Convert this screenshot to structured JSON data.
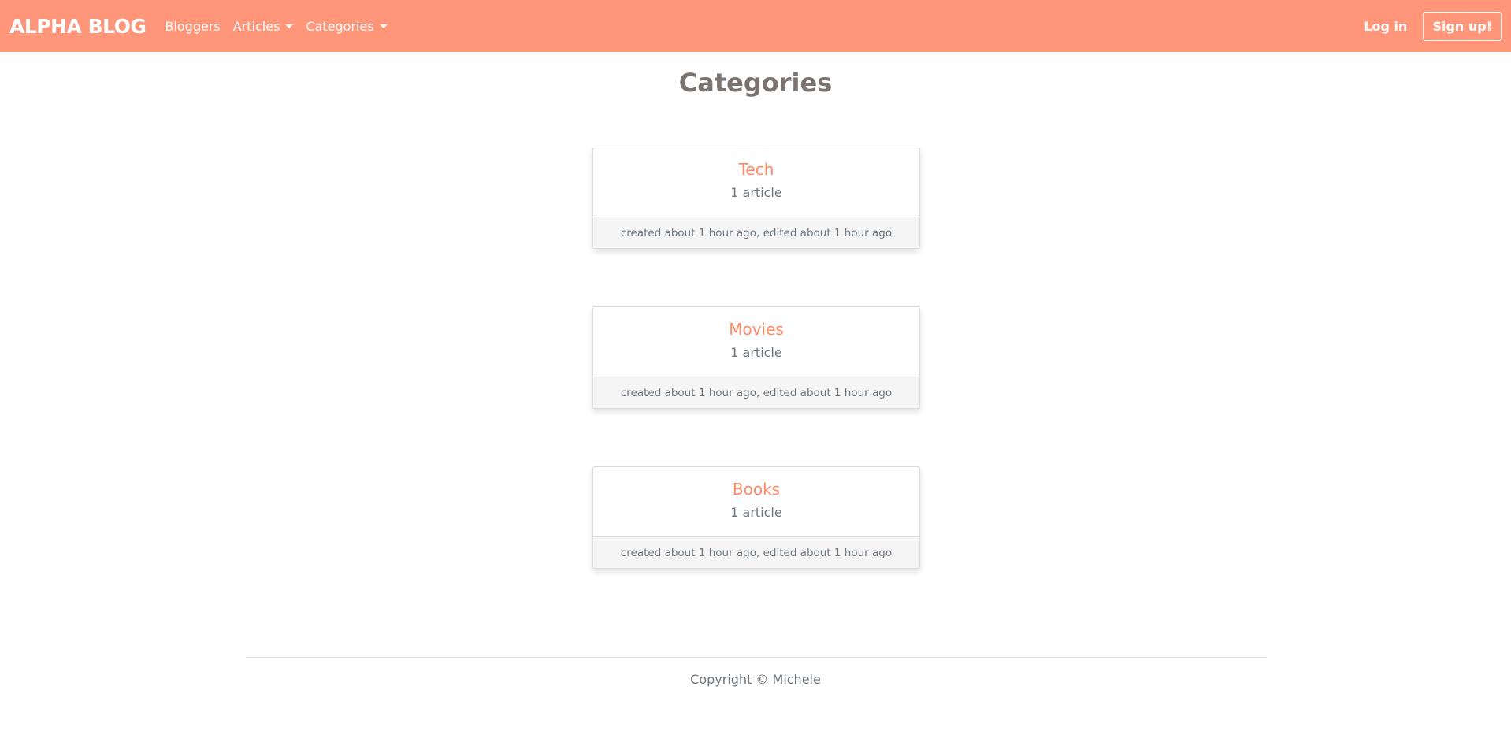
{
  "nav": {
    "brand": "ALPHA BLOG",
    "bloggers": "Bloggers",
    "articles": "Articles",
    "categories": "Categories",
    "login": "Log in",
    "signup": "Sign up!",
    "bg_color": "#ff967a"
  },
  "page": {
    "title": "Categories"
  },
  "categories": [
    {
      "name": "Tech",
      "count": "1 article",
      "meta": "created about 1 hour ago, edited about 1 hour ago"
    },
    {
      "name": "Movies",
      "count": "1 article",
      "meta": "created about 1 hour ago, edited about 1 hour ago"
    },
    {
      "name": "Books",
      "count": "1 article",
      "meta": "created about 1 hour ago, edited about 1 hour ago"
    }
  ],
  "footer": {
    "copyright": "Copyright © Michele"
  },
  "colors": {
    "accent": "#ff8a65",
    "muted_text": "#6c757d"
  }
}
